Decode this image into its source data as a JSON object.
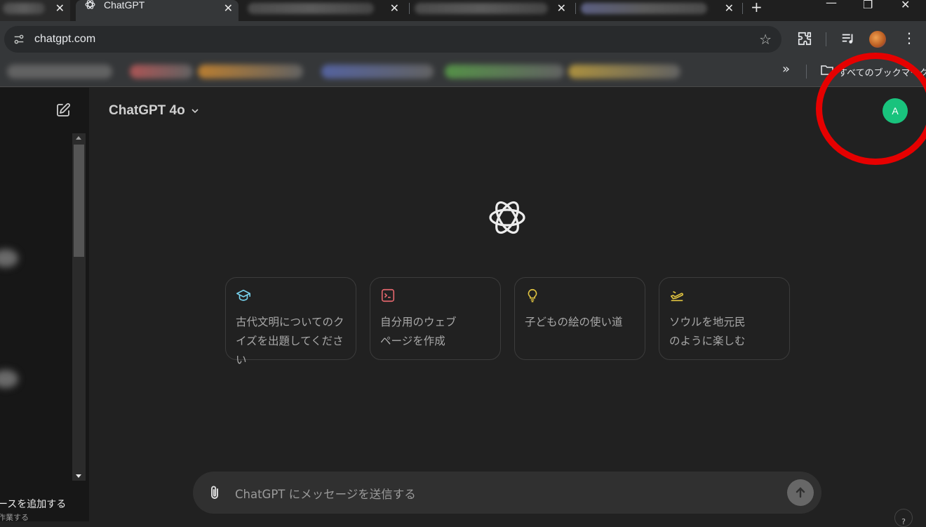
{
  "browser": {
    "tabs": [
      {
        "title": "",
        "blurred": true
      },
      {
        "title": "ChatGPT",
        "active": true
      },
      {
        "title": "",
        "blurred": true
      },
      {
        "title": "",
        "blurred": true
      },
      {
        "title": "",
        "blurred": true
      }
    ],
    "tab_close_glyph": "✕",
    "new_tab_glyph": "+",
    "window_controls": {
      "minimize": "—",
      "restore": "❐",
      "close": "✕"
    },
    "url": "chatgpt.com",
    "bookmarks_overflow": "»",
    "all_bookmarks_label": "すべてのブックマーク"
  },
  "chatgpt": {
    "model_selector": "ChatGPT 4o",
    "avatar_initial": "A",
    "avatar_color": "#19c37d",
    "suggestions": [
      {
        "icon": "graduation-cap-icon",
        "color": "#76d0eb",
        "line1": "古代文明についてのク",
        "line2": "イズを出題してください"
      },
      {
        "icon": "terminal-icon",
        "color": "#e2666c",
        "line1": "自分用のウェブ",
        "line2": "ページを作成"
      },
      {
        "icon": "lightbulb-icon",
        "color": "#e2c541",
        "line1": "子どもの絵の使い道",
        "line2": ""
      },
      {
        "icon": "airplane-icon",
        "color": "#e2c541",
        "line1": "ソウルを地元民",
        "line2": "のように楽しむ"
      }
    ],
    "composer_placeholder": "ChatGPT にメッセージを送信する",
    "sidebar_add_text": "ースを追加する",
    "sidebar_sub_text": "作業する",
    "help_label": "?"
  },
  "annotation": {
    "highlight_color": "#e60000"
  }
}
